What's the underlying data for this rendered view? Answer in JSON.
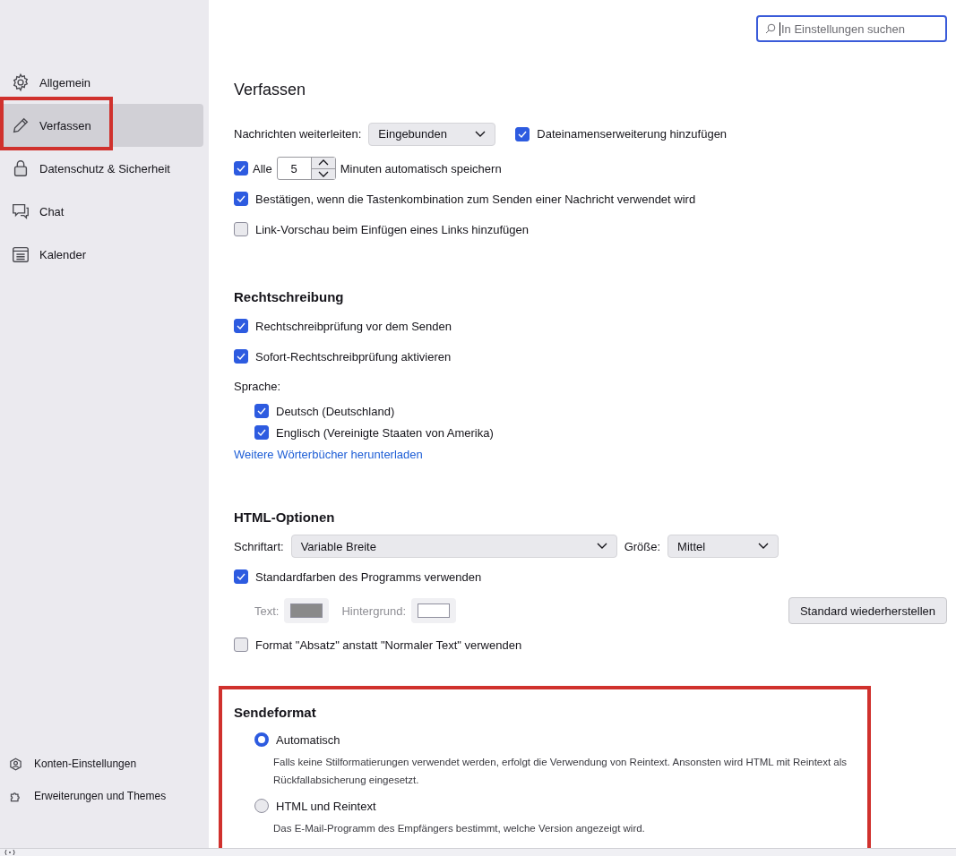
{
  "search": {
    "placeholder": "In Einstellungen suchen"
  },
  "sidebar": {
    "items": [
      {
        "label": "Allgemein",
        "selected": false,
        "highlighted": false
      },
      {
        "label": "Verfassen",
        "selected": true,
        "highlighted": true
      },
      {
        "label": "Datenschutz & Sicherheit",
        "selected": false,
        "highlighted": false
      },
      {
        "label": "Chat",
        "selected": false,
        "highlighted": false
      },
      {
        "label": "Kalender",
        "selected": false,
        "highlighted": false
      }
    ],
    "footer_items": [
      {
        "label": "Konten-Einstellungen"
      },
      {
        "label": "Erweiterungen und Themes"
      }
    ]
  },
  "sections": [
    {
      "kind": "page",
      "title": "Verfassen",
      "highlighted": false,
      "rows": [
        {
          "kind": "forward",
          "label": "Nachrichten weiterleiten:",
          "select": {
            "value": "Eingebunden"
          },
          "checkbox": {
            "label": "Dateinamenserweiterung hinzufügen",
            "checked": true
          }
        },
        {
          "kind": "autosave",
          "checkbox": {
            "label": "Alle",
            "checked": true
          },
          "value": "5",
          "suffix": "Minuten automatisch speichern"
        },
        {
          "kind": "checkbox",
          "label": "Bestätigen, wenn die Tastenkombination zum Senden einer Nachricht verwendet wird",
          "checked": true
        },
        {
          "kind": "checkbox",
          "label": "Link-Vorschau beim Einfügen eines Links hinzufügen",
          "checked": false
        }
      ]
    },
    {
      "kind": "section",
      "title": "Rechtschreibung",
      "highlighted": false,
      "rows": [
        {
          "kind": "checkbox",
          "label": "Rechtschreibprüfung vor dem Senden",
          "checked": true
        },
        {
          "kind": "checkbox",
          "label": "Sofort-Rechtschreibprüfung aktivieren",
          "checked": true
        },
        {
          "kind": "group",
          "label": "Sprache:",
          "children": [
            {
              "kind": "checkbox",
              "label": "Deutsch (Deutschland)",
              "checked": true
            },
            {
              "kind": "checkbox",
              "label": "Englisch (Vereinigte Staaten von Amerika)",
              "checked": true
            }
          ]
        },
        {
          "kind": "link",
          "label": "Weitere Wörterbücher herunterladen"
        }
      ]
    },
    {
      "kind": "section",
      "title": "HTML-Optionen",
      "highlighted": false,
      "rows": [
        {
          "kind": "font",
          "label": "Schriftart:",
          "select": {
            "value": "Variable Breite"
          },
          "size_label": "Größe:",
          "size_select": {
            "value": "Mittel"
          }
        },
        {
          "kind": "checkbox",
          "label": "Standardfarben des Programms verwenden",
          "checked": true
        },
        {
          "kind": "colors",
          "disabled": true,
          "items": [
            {
              "label": "Text:",
              "color": "#8a8a8a"
            },
            {
              "label": "Hintergrund:",
              "color": "#ffffff"
            }
          ],
          "button": "Standard wiederherstellen"
        },
        {
          "kind": "checkbox",
          "label": "Format \"Absatz\" anstatt \"Normaler Text\" verwenden",
          "checked": false
        }
      ]
    },
    {
      "kind": "section",
      "title": "Sendeformat",
      "highlighted": true,
      "rows": [
        {
          "kind": "radio",
          "label": "Automatisch",
          "selected": true,
          "description": "Falls keine Stilformatierungen verwendet werden, erfolgt die Verwendung von Reintext. Ansonsten wird HTML mit Reintext als Rückfallabsicherung eingesetzt."
        },
        {
          "kind": "radio",
          "label": "HTML und Reintext",
          "selected": false,
          "description": "Das E-Mail-Programm des Empfängers bestimmt, welche Version angezeigt wird."
        }
      ]
    }
  ]
}
